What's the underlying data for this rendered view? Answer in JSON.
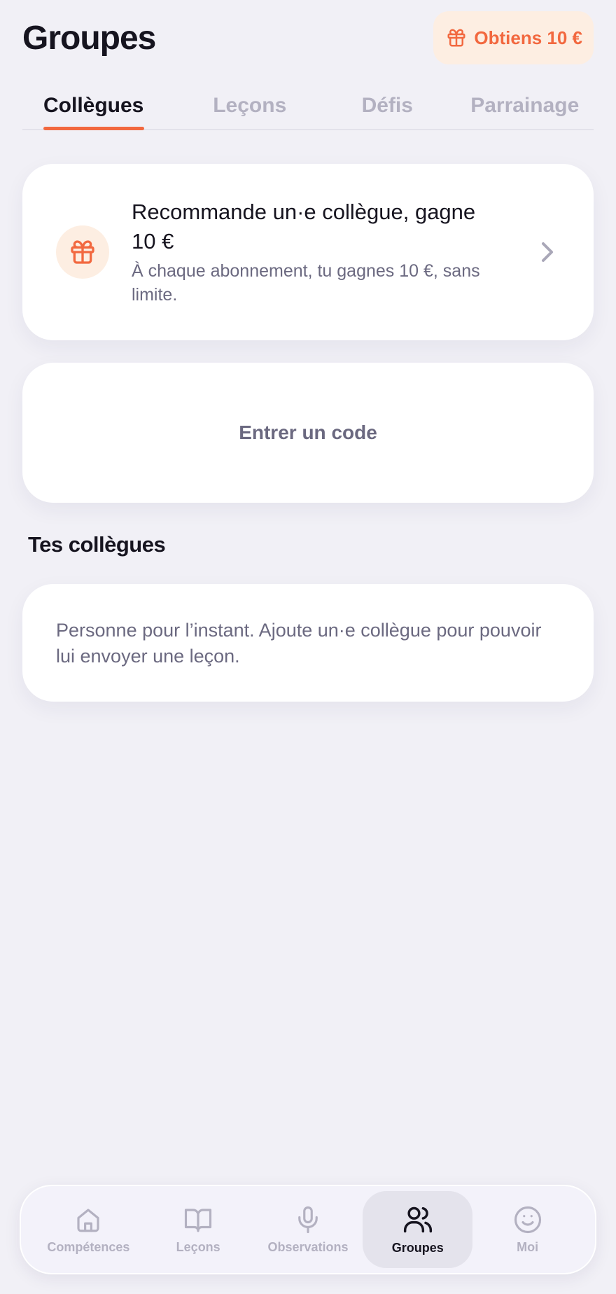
{
  "header": {
    "title": "Groupes",
    "promo_label": "Obtiens 10 €"
  },
  "tabs": [
    {
      "label": "Collègues",
      "active": true
    },
    {
      "label": "Leçons",
      "active": false
    },
    {
      "label": "Défis",
      "active": false
    },
    {
      "label": "Parrainage",
      "active": false
    }
  ],
  "referral_card": {
    "title": "Recommande un·e collègue, gagne 10 €",
    "subtitle": "À chaque abonnement, tu gagnes 10 €, sans limite.",
    "icon": "gift-icon"
  },
  "code_card": {
    "label": "Entrer un code"
  },
  "colleagues": {
    "section_title": "Tes collègues",
    "empty_text": "Personne pour l’instant. Ajoute un·e collègue pour pouvoir lui envoyer une leçon."
  },
  "bottom_nav": [
    {
      "label": "Compétences",
      "icon": "home-icon",
      "active": false
    },
    {
      "label": "Leçons",
      "icon": "book-icon",
      "active": false
    },
    {
      "label": "Observations",
      "icon": "microphone-icon",
      "active": false
    },
    {
      "label": "Groupes",
      "icon": "users-icon",
      "active": true
    },
    {
      "label": "Moi",
      "icon": "smiley-icon",
      "active": false
    }
  ],
  "colors": {
    "accent": "#f2683f",
    "accent_soft": "#fdeee2",
    "background": "#f1f0f6",
    "text": "#16141f",
    "muted": "#6b6980",
    "inactive": "#b3b1c1"
  }
}
